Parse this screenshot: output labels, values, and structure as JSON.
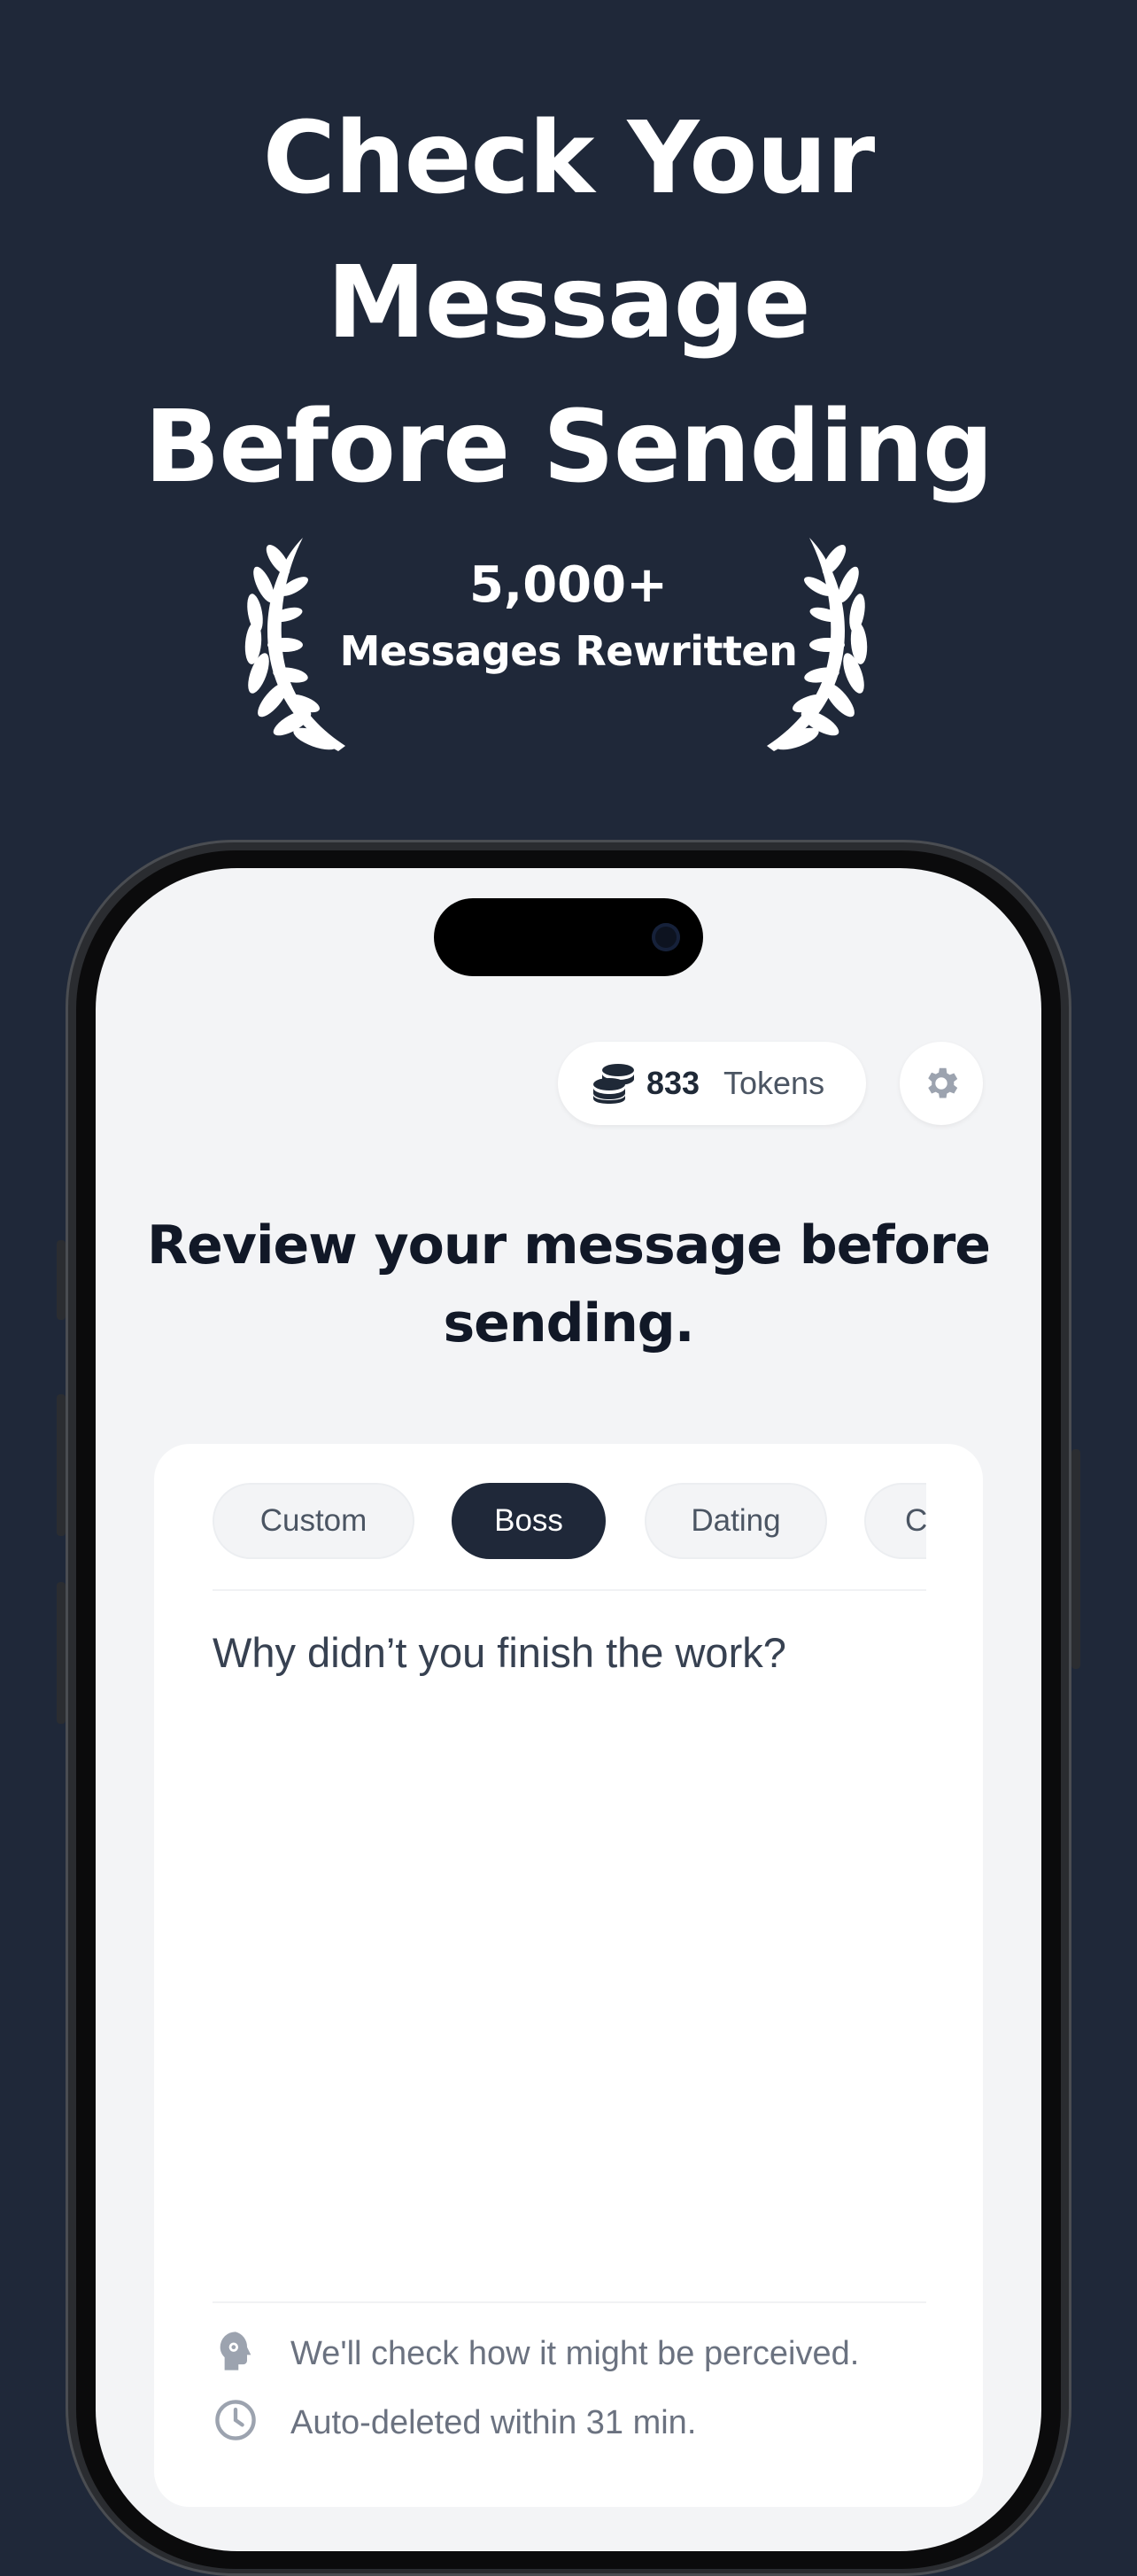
{
  "headline": {
    "line1": "Check Your",
    "line2": "Message",
    "line3": "Before Sending"
  },
  "badge": {
    "number": "5,000+",
    "label": "Messages Rewritten"
  },
  "app": {
    "tokens": {
      "count": "833",
      "label": "Tokens"
    },
    "title": "Review your message before sending.",
    "tabs": [
      {
        "label": "Custom",
        "active": false
      },
      {
        "label": "Boss",
        "active": true
      },
      {
        "label": "Dating",
        "active": false
      },
      {
        "label": "C",
        "active": false
      }
    ],
    "message": "Why didn’t you finish the work?",
    "info": [
      {
        "icon": "brain-head-icon",
        "text": "We'll check how it might be perceived."
      },
      {
        "icon": "clock-icon",
        "text": "Auto-deleted within 31 min."
      }
    ]
  },
  "colors": {
    "background": "#1f2839",
    "accent": "#1f2839",
    "screen": "#f3f4f6"
  }
}
